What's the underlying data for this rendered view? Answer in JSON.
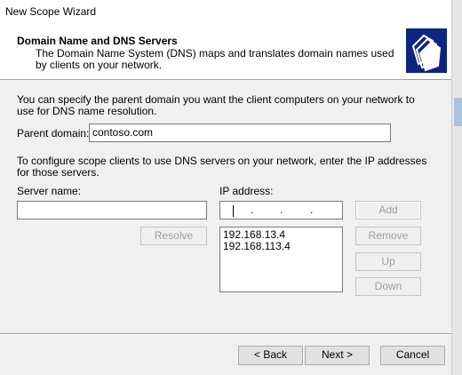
{
  "window": {
    "title": "New Scope Wizard"
  },
  "header": {
    "title": "Domain Name and DNS Servers",
    "description": "The Domain Name System (DNS) maps and translates domain names used by clients on your network."
  },
  "intro_text": "You can specify the parent domain you want the client computers on your network to use for DNS name resolution.",
  "parent_domain": {
    "label": "Parent domain:",
    "value": "contoso.com"
  },
  "configure_text": "To configure scope clients to use DNS servers on your network, enter the IP addresses for those servers.",
  "server_name": {
    "label": "Server name:",
    "value": ""
  },
  "ip_address": {
    "label": "IP address:",
    "value": "",
    "dots": [
      ".",
      ".",
      "."
    ]
  },
  "buttons": {
    "add": "Add",
    "resolve": "Resolve",
    "remove": "Remove",
    "up": "Up",
    "down": "Down",
    "back": "< Back",
    "next": "Next >",
    "cancel": "Cancel"
  },
  "ip_list": [
    "192.168.13.4",
    "192.168.113.4"
  ],
  "icons": {
    "header": "wizard-folders-icon"
  }
}
